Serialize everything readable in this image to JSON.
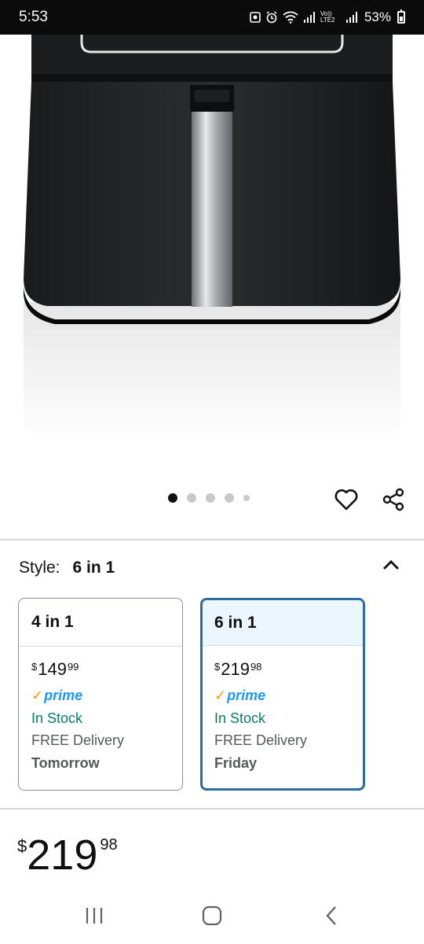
{
  "status_bar": {
    "time": "5:53",
    "battery": "53%",
    "icons": [
      "photo-icon",
      "alarm-icon",
      "wifi-icon",
      "signal-icon",
      "volte-icon",
      "signal-icon",
      "battery-icon"
    ],
    "volte_label": "Vo)) LTE2"
  },
  "product": {
    "image_alt": "air-fryer-image",
    "carousel": {
      "count": 5,
      "active_index": 0
    }
  },
  "actions": {
    "wishlist_icon": "heart-icon",
    "share_icon": "share-icon"
  },
  "style": {
    "label": "Style:",
    "value": "6 in 1",
    "collapse_icon": "chevron-up-icon"
  },
  "options": [
    {
      "name": "4 in 1",
      "price_symbol": "$",
      "price_whole": "149",
      "price_cents": "99",
      "prime": "prime",
      "stock": "In Stock",
      "delivery": "FREE Delivery",
      "delivery_day": "Tomorrow",
      "selected": false
    },
    {
      "name": "6 in 1",
      "price_symbol": "$",
      "price_whole": "219",
      "price_cents": "98",
      "prime": "prime",
      "stock": "In Stock",
      "delivery": "FREE Delivery",
      "delivery_day": "Friday",
      "selected": true
    }
  ],
  "price": {
    "symbol": "$",
    "whole": "219",
    "cents": "98"
  },
  "colors": {
    "accent_border": "#2d6ca3",
    "selected_header": "#eaf5fc",
    "in_stock": "#067d62",
    "prime_blue": "#1a98ff",
    "prime_check": "#ff9900"
  },
  "nav": {
    "recent_icon": "recent-apps-icon",
    "home_icon": "home-icon",
    "back_icon": "back-icon"
  }
}
